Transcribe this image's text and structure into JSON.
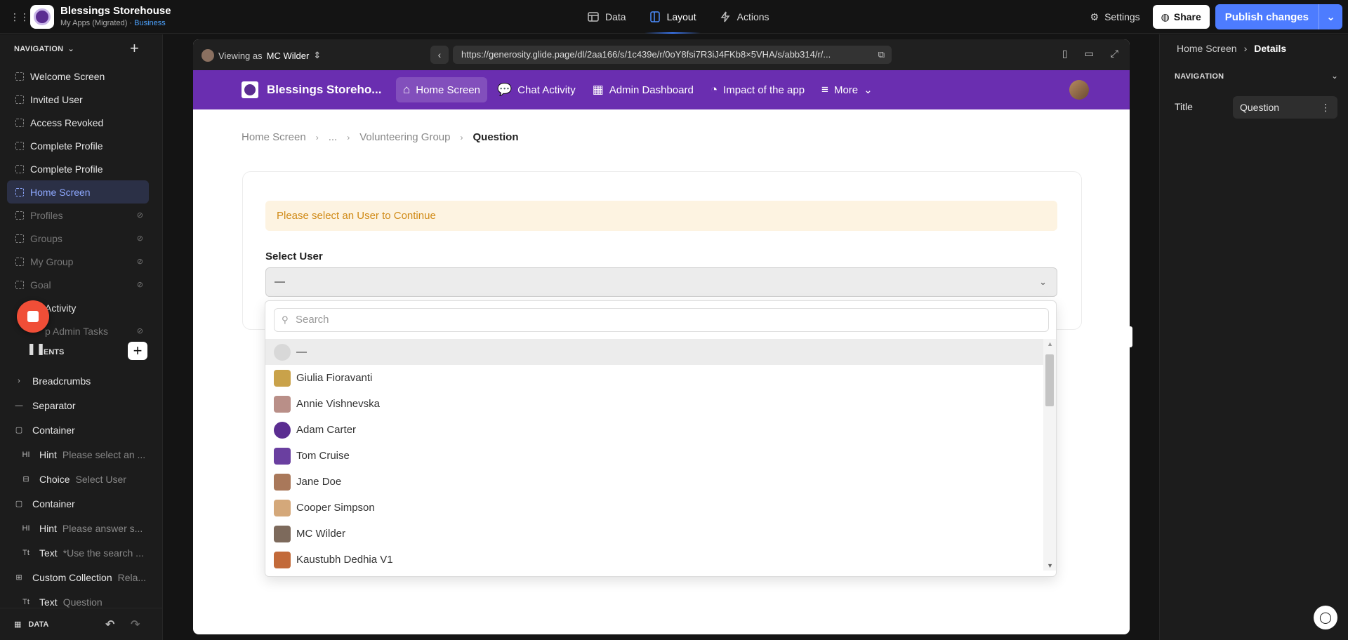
{
  "topbar": {
    "app_title": "Blessings Storehouse",
    "app_subtitle": "My Apps (Migrated) · ",
    "plan": "Business",
    "modes": [
      {
        "label": "Data"
      },
      {
        "label": "Layout"
      },
      {
        "label": "Actions"
      }
    ],
    "active_mode": "Layout",
    "settings_label": "Settings",
    "share_label": "Share",
    "publish_label": "Publish changes"
  },
  "sidebar": {
    "nav_header": "NAVIGATION",
    "screens": [
      {
        "label": "Welcome Screen",
        "state": "normal"
      },
      {
        "label": "Invited User",
        "state": "normal"
      },
      {
        "label": "Access Revoked",
        "state": "normal"
      },
      {
        "label": "Complete Profile",
        "state": "normal"
      },
      {
        "label": "Complete Profile",
        "state": "normal"
      },
      {
        "label": "Home Screen",
        "state": "active"
      },
      {
        "label": "Profiles",
        "state": "hidden"
      },
      {
        "label": "Groups",
        "state": "hidden"
      },
      {
        "label": "My Group",
        "state": "hidden"
      },
      {
        "label": "Goal",
        "state": "hidden"
      },
      {
        "label": "Activity",
        "state": "normal"
      },
      {
        "label": "p Admin Tasks",
        "state": "hidden"
      }
    ],
    "components_header": "ENTS",
    "components": [
      {
        "icon": "›",
        "type": "Breadcrumbs",
        "detail": ""
      },
      {
        "icon": "—",
        "type": "Separator",
        "detail": ""
      },
      {
        "icon": "▢",
        "type": "Container",
        "detail": ""
      },
      {
        "icon": "HI",
        "type": "Hint",
        "detail": "Please select an ..."
      },
      {
        "icon": "⊟",
        "type": "Choice",
        "detail": "Select User"
      },
      {
        "icon": "▢",
        "type": "Container",
        "detail": ""
      },
      {
        "icon": "HI",
        "type": "Hint",
        "detail": "Please answer s..."
      },
      {
        "icon": "Tt",
        "type": "Text",
        "detail": "*Use the search ..."
      },
      {
        "icon": "⊞",
        "type": "Custom Collection",
        "detail": "Rela..."
      },
      {
        "icon": "Tt",
        "type": "Text",
        "detail": "Question"
      }
    ],
    "data_label": "DATA"
  },
  "preview": {
    "viewing_prefix": "Viewing as",
    "viewing_user": "MC Wilder",
    "url": "https://generosity.glide.page/dl/2aa166/s/1c439e/r/0oY8fsi7R3iJ4FKb8×5VHA/s/abb314/r/...",
    "app_header": {
      "title": "Blessings Storeho...",
      "tabs": [
        {
          "icon": "⌂",
          "label": "Home Screen",
          "active": true
        },
        {
          "icon": "💬",
          "label": "Chat Activity",
          "active": false
        },
        {
          "icon": "▦",
          "label": "Admin Dashboard",
          "active": false
        },
        {
          "icon": "◔",
          "label": "Impact of the app",
          "active": false
        },
        {
          "icon": "≡",
          "label": "More",
          "active": false
        }
      ]
    },
    "breadcrumbs": [
      "Home Screen",
      "...",
      "Volunteering Group",
      "Question"
    ],
    "hint_text": "Please select an User to Continue",
    "select_label": "Select User",
    "select_value": "—",
    "search_placeholder": "Search",
    "options": [
      {
        "label": "—",
        "color": "#d8d8d8"
      },
      {
        "label": "Giulia Fioravanti",
        "color": "#c9a24a"
      },
      {
        "label": "Annie Vishnevska",
        "color": "#b98f88"
      },
      {
        "label": "Adam Carter",
        "color": "#5b2d91"
      },
      {
        "label": "Tom Cruise",
        "color": "#6a3fa0"
      },
      {
        "label": "Jane Doe",
        "color": "#a9785a"
      },
      {
        "label": "Cooper Simpson",
        "color": "#d4a87a"
      },
      {
        "label": "MC Wilder",
        "color": "#7d6a5c"
      },
      {
        "label": "Kaustubh Dedhia V1",
        "color": "#c26a3a"
      }
    ]
  },
  "right_panel": {
    "crumb_parent": "Home Screen",
    "crumb_current": "Details",
    "section": "NAVIGATION",
    "title_label": "Title",
    "title_value": "Question"
  }
}
